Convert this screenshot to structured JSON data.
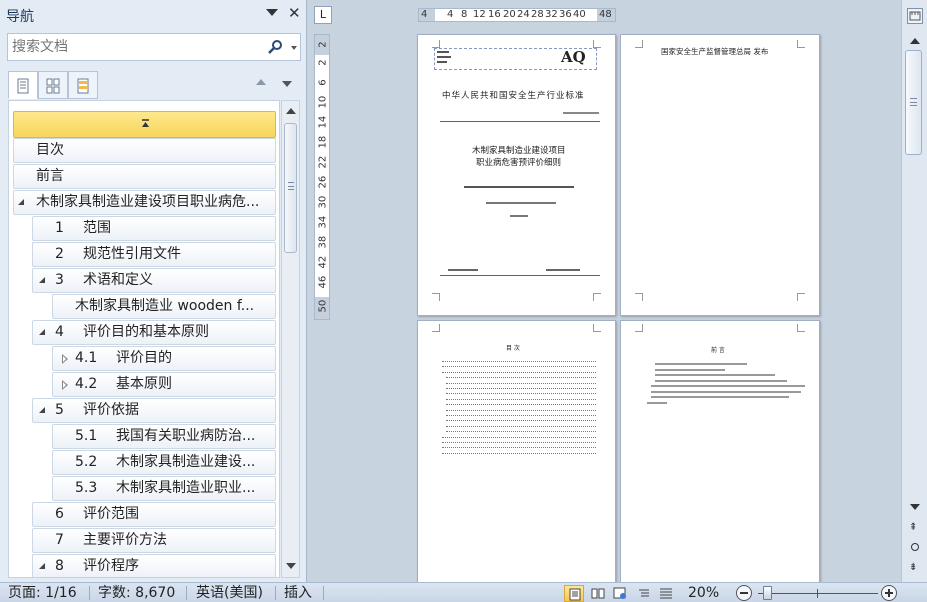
{
  "nav": {
    "title": "导航",
    "search_placeholder": "搜索文档",
    "headings": [
      {
        "num": "",
        "text": "目次"
      },
      {
        "num": "",
        "text": "前言"
      },
      {
        "num": "",
        "text": "木制家具制造业建设项目职业病危..."
      },
      {
        "num": "1",
        "text": "范围"
      },
      {
        "num": "2",
        "text": "规范性引用文件"
      },
      {
        "num": "3",
        "text": "术语和定义"
      },
      {
        "num": "",
        "text": "木制家具制造业  wooden f..."
      },
      {
        "num": "4",
        "text": "评价目的和基本原则"
      },
      {
        "num": "4.1",
        "text": "评价目的"
      },
      {
        "num": "4.2",
        "text": "基本原则"
      },
      {
        "num": "5",
        "text": "评价依据"
      },
      {
        "num": "5.1",
        "text": "我国有关职业病防治..."
      },
      {
        "num": "5.2",
        "text": "木制家具制造业建设..."
      },
      {
        "num": "5.3",
        "text": "木制家具制造业职业..."
      },
      {
        "num": "6",
        "text": "评价范围"
      },
      {
        "num": "7",
        "text": "主要评价方法"
      },
      {
        "num": "8",
        "text": "评价程序"
      }
    ]
  },
  "ruler": {
    "corner": "L",
    "h_ticks": [
      "4",
      "4",
      "8",
      "12",
      "16",
      "20",
      "24",
      "28",
      "32",
      "36",
      "40",
      "48"
    ],
    "v_ticks": [
      "2",
      "2",
      "6",
      "10",
      "14",
      "18",
      "22",
      "26",
      "30",
      "34",
      "38",
      "42",
      "46",
      "50"
    ]
  },
  "pages": {
    "p1": {
      "logo": "AQ",
      "industry_standard": "中华人民共和国安全生产行业标准",
      "title_line1": "木制家具制造业建设项目",
      "title_line2": "职业病危害预评价细则"
    },
    "p2": {
      "publisher": "国家安全生产监督管理总局   发布"
    },
    "p3": {
      "toc_title": "目    次"
    },
    "p4": {
      "preface_title": "前    言"
    }
  },
  "status": {
    "page": "页面: 1/16",
    "words": "字数: 8,670",
    "language": "英语(美国)",
    "mode": "插入",
    "zoom": "20%",
    "zoom_percent": 20
  }
}
